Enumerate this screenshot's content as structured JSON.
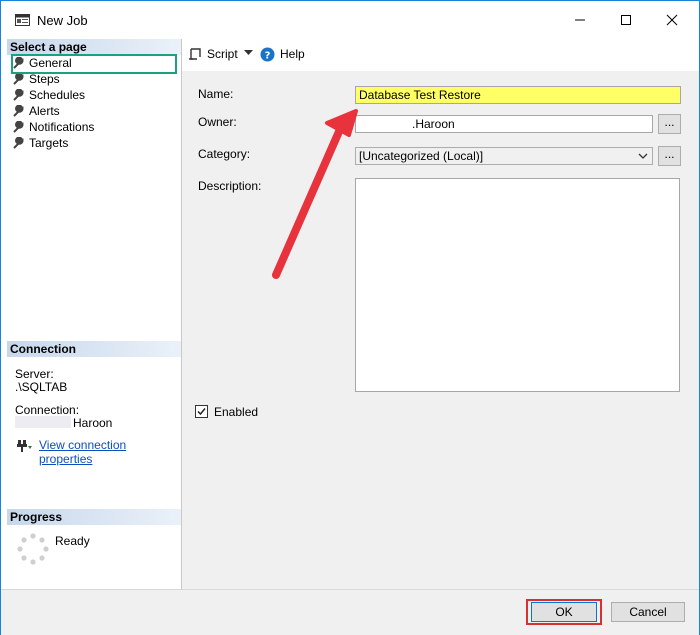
{
  "window": {
    "title": "New Job"
  },
  "sidebar": {
    "select_page_header": "Select a page",
    "pages": [
      "General",
      "Steps",
      "Schedules",
      "Alerts",
      "Notifications",
      "Targets"
    ],
    "connection_header": "Connection",
    "server_label": "Server:",
    "server_value": ".\\SQLTAB",
    "connection_label": "Connection:",
    "connection_value": "Haroon",
    "view_link": "View connection properties",
    "progress_header": "Progress",
    "progress_status": "Ready"
  },
  "toolbar": {
    "script_label": "Script",
    "help_label": "Help"
  },
  "form": {
    "name_label": "Name:",
    "name_value": "Database Test Restore",
    "owner_label": "Owner:",
    "owner_value": ".Haroon",
    "category_label": "Category:",
    "category_value": "[Uncategorized (Local)]",
    "description_label": "Description:",
    "browse_label": "...",
    "enabled_label": "Enabled"
  },
  "buttons": {
    "ok": "OK",
    "cancel": "Cancel"
  },
  "colors": {
    "highlight": "#ffff66",
    "arrow": "#e8323c",
    "selection_box": "#1aa180",
    "ok_box": "#d9302f",
    "window_border": "#1883d7"
  }
}
